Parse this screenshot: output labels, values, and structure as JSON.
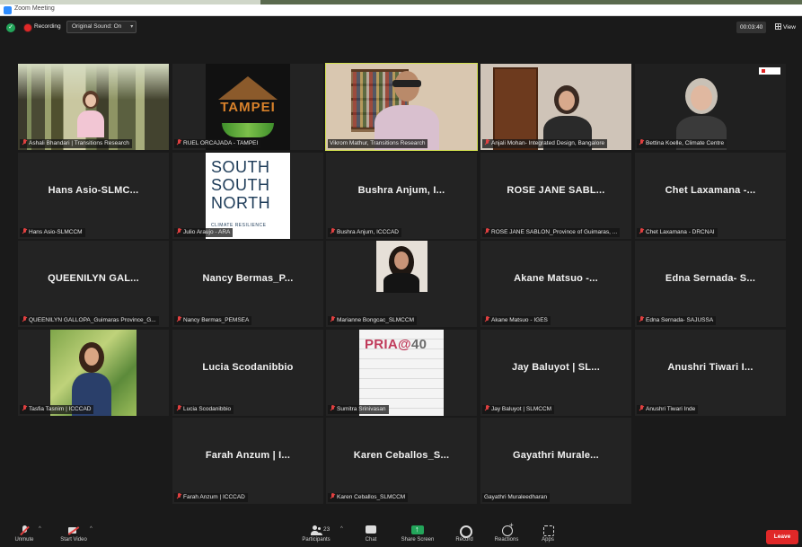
{
  "window": {
    "title": "Zoom Meeting"
  },
  "topbar": {
    "recording_label": "Recording",
    "sound_label": "Original Sound: On",
    "timer": "00:03:40",
    "view_label": "View"
  },
  "participants": [
    {
      "label": "Ashali Bhandari | Transitions Research",
      "muted": true,
      "video": "forest"
    },
    {
      "label": "RUEL ORCAJADA - TAMPEI",
      "muted": true,
      "video": "tampei"
    },
    {
      "label": "Vikrom Mathur, Transitions Research",
      "muted": false,
      "video": "room",
      "active": true
    },
    {
      "label": "Anjali Mohan- Integrated Design, Bangalore",
      "muted": true,
      "video": "door"
    },
    {
      "label": "Bettina Koelle, Climate Centre",
      "muted": true,
      "video": "dark"
    },
    {
      "label": "Hans Asio-SLMCCM",
      "display": "Hans Asio-SLMC...",
      "muted": true
    },
    {
      "label": "Julio Araujo - ARA",
      "muted": true,
      "video": "ssn"
    },
    {
      "label": "Bushra Anjum, ICCCAD",
      "display": "Bushra Anjum, I...",
      "muted": true
    },
    {
      "label": "ROSE JANE SABLON_Province of Guimaras, ...",
      "display": "ROSE JANE SABL...",
      "muted": true
    },
    {
      "label": "Chet Laxamana - DRCNAI",
      "display": "Chet Laxamana -...",
      "muted": true
    },
    {
      "label": "QUEENILYN GALLOPA_Guimaras Province_G...",
      "display": "QUEENILYN GAL...",
      "muted": true
    },
    {
      "label": "Nancy Bermas_PEMSEA",
      "display": "Nancy Bermas_P...",
      "muted": true
    },
    {
      "label": "Marianne Bongcac_SLMCCM",
      "muted": true,
      "video": "portrait"
    },
    {
      "label": "Akane Matsuo - IGES",
      "display": "Akane Matsuo -...",
      "muted": true
    },
    {
      "label": "Edna Sernada- SAJUSSA",
      "display": "Edna Sernada- S...",
      "muted": true
    },
    {
      "label": "Tasfia Tasnim | ICCCAD",
      "muted": true,
      "video": "garden"
    },
    {
      "label": "Lucia Scodanibbio",
      "display": "Lucia Scodanibbio",
      "muted": true
    },
    {
      "label": "Sumitra Srinivasan",
      "muted": true,
      "video": "pria"
    },
    {
      "label": "Jay Baluyot | SLMCCM",
      "display": "Jay Baluyot | SL...",
      "muted": true
    },
    {
      "label": "Anushri Tiwari Inde",
      "display": "Anushri Tiwari I...",
      "muted": true
    },
    {
      "label": "Farah Anzum | ICCCAD",
      "display": "Farah Anzum | I...",
      "muted": true
    },
    {
      "label": "Karen Ceballos_SLMCCM",
      "display": "Karen Ceballos_S...",
      "muted": true
    },
    {
      "label": "Gayathri Muraleedharan",
      "display": "Gayathri Murale...",
      "muted": false
    }
  ],
  "video_text": {
    "tampei": "TAMPEI",
    "ssn_lines": [
      "SOUTH",
      "SOUTH",
      "NORTH"
    ],
    "ssn_tag": "CLIMATE RESILIENCE",
    "pria_prefix": "PRIA@",
    "pria_suffix": "40"
  },
  "toolbar": {
    "unmute": "Unmute",
    "start_video": "Start Video",
    "participants": "Participants",
    "participants_count": "23",
    "chat": "Chat",
    "share_screen": "Share Screen",
    "record": "Record",
    "reactions": "Reactions",
    "apps": "Apps",
    "leave": "Leave"
  },
  "colors": {
    "active_speaker": "#d2e04f",
    "share_green": "#23a55a",
    "leave_red": "#e02828"
  }
}
